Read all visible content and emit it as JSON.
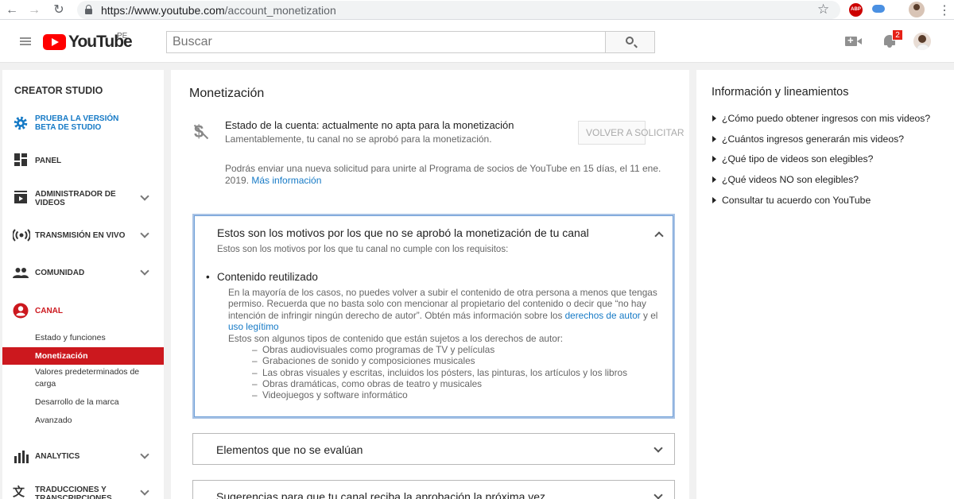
{
  "browser": {
    "url_host": "https://www.youtube.com",
    "url_path": "/account_monetization",
    "ext_abp": "ABP"
  },
  "header": {
    "logo_text": "YouTube",
    "region": "PE",
    "search_placeholder": "Buscar",
    "notification_count": "2"
  },
  "sidebar": {
    "title": "CREATOR STUDIO",
    "beta_label": "PRUEBA LA VERSIÓN BETA DE STUDIO",
    "items": [
      {
        "label": "PANEL"
      },
      {
        "label": "ADMINISTRADOR DE VIDEOS"
      },
      {
        "label": "TRANSMISIÓN EN VIVO"
      },
      {
        "label": "COMUNIDAD"
      },
      {
        "label": "CANAL"
      },
      {
        "label": "ANALYTICS"
      },
      {
        "label": "TRADUCCIONES Y TRANSCRIPCIONES"
      }
    ],
    "channel_sub": [
      {
        "label": "Estado y funciones"
      },
      {
        "label": "Monetización"
      },
      {
        "label": "Valores predeterminados de carga"
      },
      {
        "label": "Desarrollo de la marca"
      },
      {
        "label": "Avanzado"
      }
    ],
    "accent_color": "#cc181e",
    "beta_color": "#167ac6"
  },
  "main": {
    "title": "Monetización",
    "status_title": "Estado de la cuenta: actualmente no apta para la monetización",
    "status_sub": "Lamentablemente, tu canal no se aprobó para la monetización.",
    "reapply_button": "VOLVER A SOLICITAR",
    "apply_note": "Podrás enviar una nueva solicitud para unirte al Programa de socios de YouTube en 15 días, el 11 ene. 2019.",
    "apply_note_link": "Más información",
    "panel_reasons": {
      "title": "Estos son los motivos por los que no se aprobó la monetización de tu canal",
      "subtitle": "Estos son los motivos por los que tu canal no cumple con los requisitos:",
      "bullet_title": "Contenido reutilizado",
      "text": "En la mayoría de los casos, no puedes volver a subir el contenido de otra persona a menos que tengas permiso. Recuerda que no basta solo con mencionar al propietario del contenido o decir que “no hay intención de infringir ningún derecho de autor”. Obtén más información sobre los",
      "link_copyright": "derechos de autor",
      "conj_y": "y",
      "conj_el": "el",
      "link_fair_use": "uso legítimo",
      "types_intro": "Estos son algunos tipos de contenido que están sujetos a los derechos de autor:",
      "types": [
        "Obras audiovisuales como programas de TV y películas",
        "Grabaciones de sonido y composiciones musicales",
        "Las obras visuales y escritas, incluidos los pósters, las pinturas, los artículos y los libros",
        "Obras dramáticas, como obras de teatro y musicales",
        "Videojuegos y software informático"
      ]
    },
    "panel_not_evaluated": "Elementos que no se evalúan",
    "panel_suggestions": "Sugerencias para que tu canal reciba la aprobación la próxima vez"
  },
  "info": {
    "title": "Información y lineamientos",
    "links": [
      "¿Cómo puedo obtener ingresos con mis videos?",
      "¿Cuántos ingresos generarán mis videos?",
      "¿Qué tipo de videos son elegibles?",
      "¿Qué videos NO son elegibles?",
      "Consultar tu acuerdo con YouTube"
    ]
  }
}
